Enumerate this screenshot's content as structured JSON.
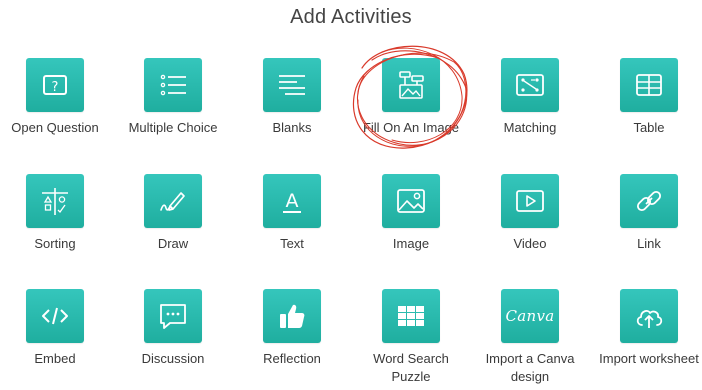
{
  "header": {
    "title": "Add Activities"
  },
  "colors": {
    "accent": "#27b8ac",
    "annotation": "#d93a2b"
  },
  "activities": [
    {
      "label": "Open Question",
      "icon": "question-box-icon"
    },
    {
      "label": "Multiple Choice",
      "icon": "list-icon"
    },
    {
      "label": "Blanks",
      "icon": "text-lines-icon"
    },
    {
      "label": "Fill On An Image",
      "icon": "fill-on-image-icon"
    },
    {
      "label": "Matching",
      "icon": "matching-icon"
    },
    {
      "label": "Table",
      "icon": "table-icon"
    },
    {
      "label": "Sorting",
      "icon": "sorting-icon"
    },
    {
      "label": "Draw",
      "icon": "pencil-icon"
    },
    {
      "label": "Text",
      "icon": "text-a-icon"
    },
    {
      "label": "Image",
      "icon": "image-icon"
    },
    {
      "label": "Video",
      "icon": "video-play-icon"
    },
    {
      "label": "Link",
      "icon": "link-icon"
    },
    {
      "label": "Embed",
      "icon": "code-icon"
    },
    {
      "label": "Discussion",
      "icon": "chat-bubble-icon"
    },
    {
      "label": "Reflection",
      "icon": "thumbs-up-icon"
    },
    {
      "label": "Word Search Puzzle",
      "icon": "grid-icon"
    },
    {
      "label": "Import a Canva design",
      "icon": "canva-logo",
      "logo_text": "Canva"
    },
    {
      "label": "Import worksheet",
      "icon": "cloud-upload-icon"
    }
  ]
}
